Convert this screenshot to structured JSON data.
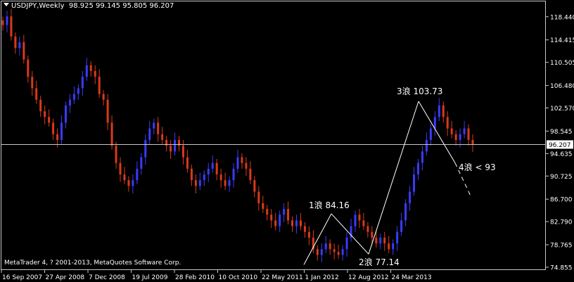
{
  "header": {
    "symbol_timeframe": "USDJPY,Weekly",
    "ohlc": "98.925 99.145 95.805 96.207"
  },
  "footer": {
    "copyright": "MetaTrader 4, ? 2001-2013, MetaQuotes Software Corp."
  },
  "colors": {
    "background": "#000000",
    "bull": "#3a3aff",
    "bear": "#d83a1a",
    "grid": "#c8c8c8",
    "text": "#ffffff"
  },
  "chart_data": {
    "type": "candlestick",
    "title": "",
    "ylim": [
      74.855,
      120.375
    ],
    "price_scale_ticks": [
      "118.440",
      "114.415",
      "110.505",
      "106.480",
      "102.570",
      "98.545",
      "94.635",
      "90.725",
      "86.700",
      "82.790",
      "78.765",
      "74.855"
    ],
    "date_ticks": [
      "16 Sep 2007",
      "27 Apr 2008",
      "7 Dec 2008",
      "19 Jul 2009",
      "28 Feb 2010",
      "10 Oct 2010",
      "22 May 2011",
      "1 Jan 2012",
      "12 Aug 2012",
      "24 Mar 2013"
    ],
    "current_price": "96.207",
    "closes_approx": [
      117,
      118.5,
      115,
      113,
      114,
      111,
      108,
      106,
      104,
      102,
      101,
      100,
      98,
      97,
      100,
      103,
      104,
      105,
      106,
      108,
      110,
      109,
      108,
      105,
      104,
      100,
      96,
      93,
      91,
      90,
      89,
      90,
      92,
      94,
      97,
      99,
      100,
      98,
      97,
      96,
      95,
      97,
      96,
      94,
      92,
      90,
      89,
      90,
      91,
      92,
      93,
      91,
      90,
      89,
      90,
      92,
      94,
      93,
      92,
      90,
      88,
      86,
      85,
      84,
      83,
      82,
      84,
      85,
      83,
      82,
      83,
      82,
      81,
      80,
      78,
      77,
      78,
      79,
      78,
      77.5,
      77,
      78,
      80,
      82,
      84,
      83,
      82,
      81,
      80,
      79,
      80,
      79,
      78,
      79,
      81,
      83,
      86,
      88,
      91,
      93,
      95,
      97,
      99,
      101,
      103,
      101,
      99,
      98,
      97,
      98,
      99,
      97,
      96.2
    ],
    "wave_labels": [
      "1浪 84.16",
      "2浪 77.14",
      "3浪 103.73",
      "4浪 < 93"
    ],
    "wave_points": [
      [
        75.3,
        "wave-start"
      ],
      [
        84.16,
        "1"
      ],
      [
        77.14,
        "2"
      ],
      [
        103.73,
        "3"
      ],
      [
        93,
        "4-target-start"
      ],
      [
        87,
        "4-target-end"
      ]
    ]
  }
}
